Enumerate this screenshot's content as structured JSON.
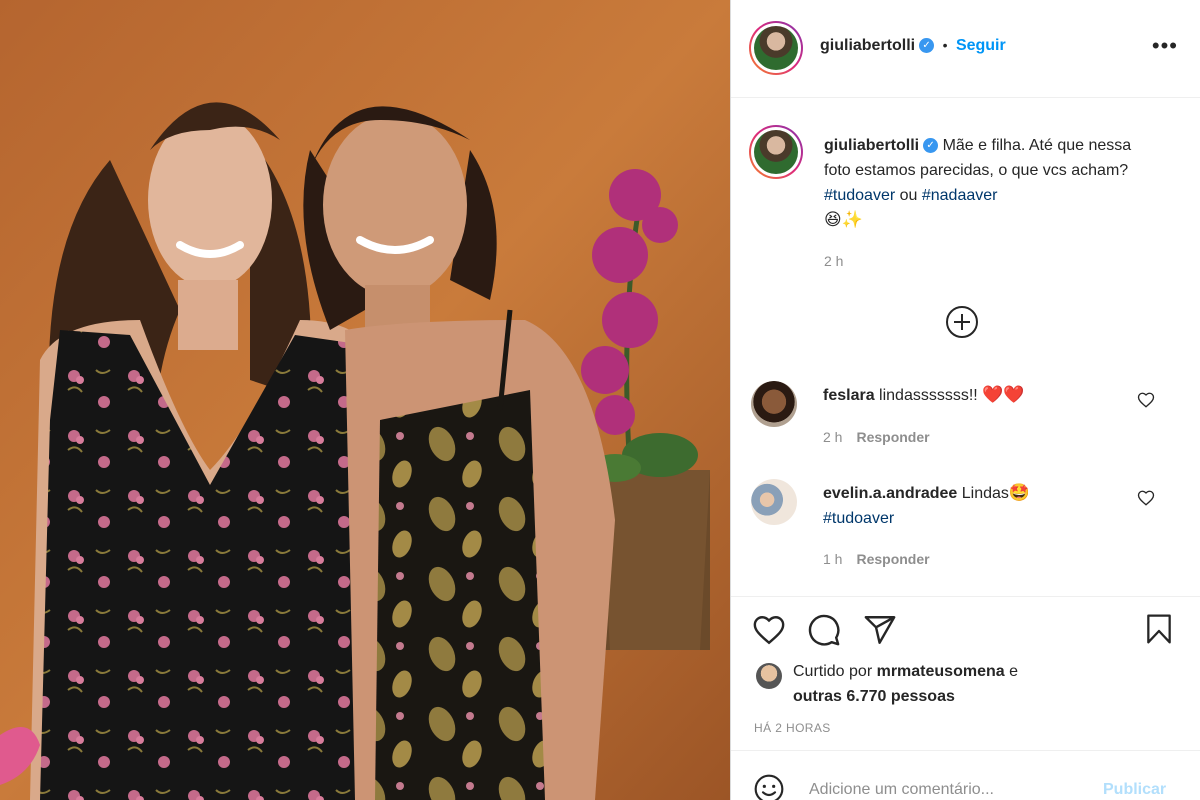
{
  "post": {
    "username": "giuliabertolli",
    "follow_label": "Seguir",
    "dot_separator": "•",
    "more_icon": "more-horizontal-icon"
  },
  "caption": {
    "username": "giuliabertolli",
    "text_before": "Mãe e filha. Até que nessa foto estamos parecidas, o que vcs acham? ",
    "hashtag1": "#tudoaver",
    "connector": " ou ",
    "hashtag2": "#nadaaver",
    "emojis": "😆✨",
    "time": "2 h"
  },
  "comments": [
    {
      "username": "feslara",
      "text": "lindasssssss!! ",
      "emojis": "❤️❤️",
      "time": "2 h",
      "reply_label": "Responder"
    },
    {
      "username": "evelin.a.andradee",
      "text": "Lindas",
      "emojis": "🤩",
      "hashtag": "#tudoaver",
      "time": "1 h",
      "reply_label": "Responder"
    }
  ],
  "likes": {
    "prefix": "Curtido por ",
    "username": "mrmateusomena",
    "connector": " e",
    "others": "outras 6.770 pessoas"
  },
  "timestamp": "HÁ 2 HORAS",
  "comment_box": {
    "placeholder": "Adicione um comentário...",
    "publish_label": "Publicar"
  },
  "colors": {
    "accent": "#0095f6",
    "hashtag": "#00376b",
    "muted": "#8e8e8e",
    "wall": "#c87a3c"
  }
}
